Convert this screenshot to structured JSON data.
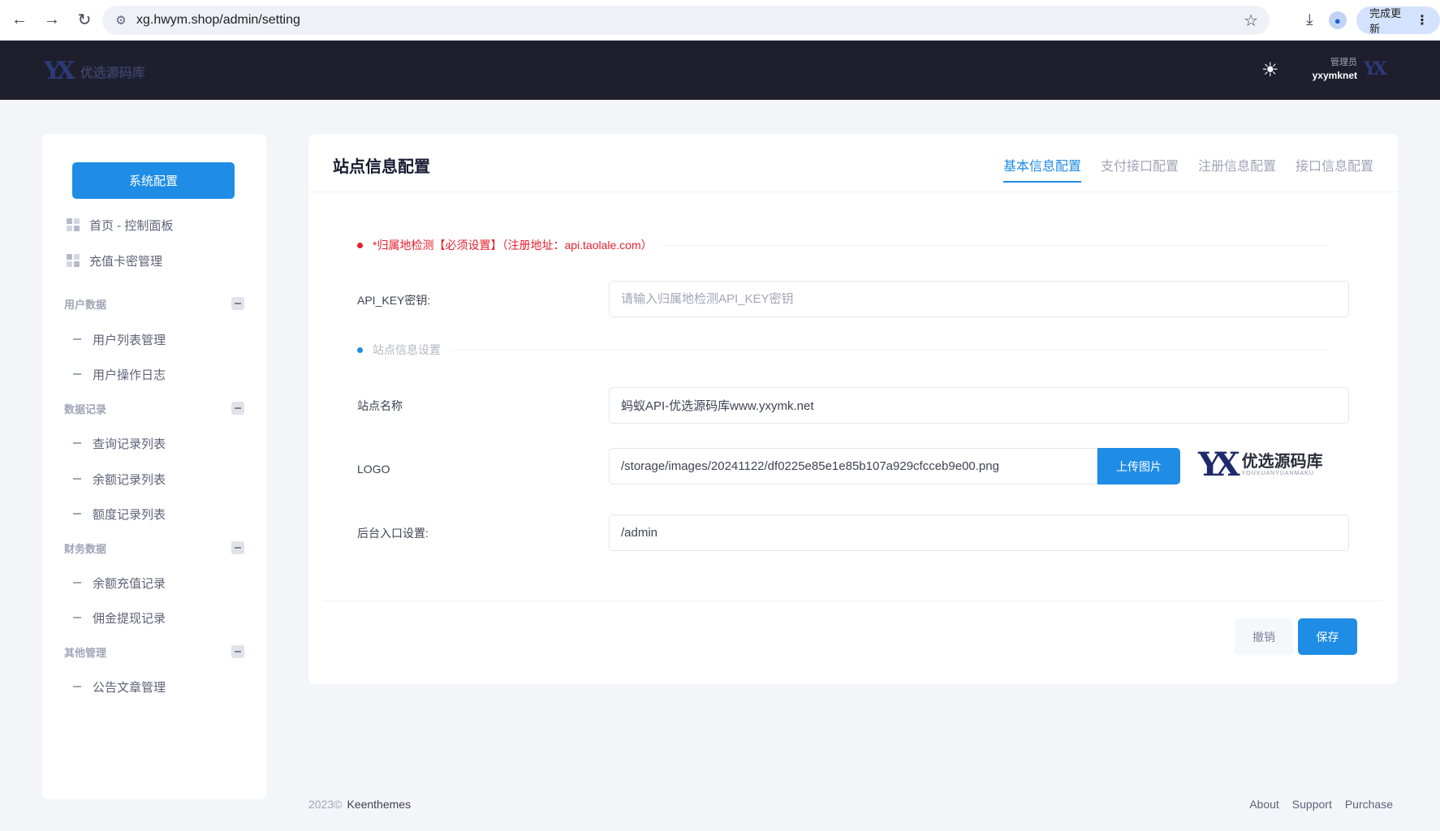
{
  "browser": {
    "url": "xg.hwym.shop/admin/setting",
    "update_label": "完成更新"
  },
  "header": {
    "brand_name": "优选源码库",
    "user_role": "管理员",
    "user_name": "yxymknet"
  },
  "sidebar": {
    "system_button": "系统配置",
    "items": [
      {
        "label": "首页 - 控制面板"
      },
      {
        "label": "充值卡密管理"
      }
    ],
    "sections": [
      {
        "title": "用户数据",
        "items": [
          {
            "label": "用户列表管理"
          },
          {
            "label": "用户操作日志"
          }
        ]
      },
      {
        "title": "数据记录",
        "items": [
          {
            "label": "查询记录列表"
          },
          {
            "label": "余额记录列表"
          },
          {
            "label": "额度记录列表"
          }
        ]
      },
      {
        "title": "财务数据",
        "items": [
          {
            "label": "余额充值记录"
          },
          {
            "label": "佣金提现记录"
          }
        ]
      },
      {
        "title": "其他管理",
        "items": [
          {
            "label": "公告文章管理"
          }
        ]
      }
    ]
  },
  "main": {
    "title": "站点信息配置",
    "tabs": [
      {
        "label": "基本信息配置",
        "active": true
      },
      {
        "label": "支付接口配置",
        "active": false
      },
      {
        "label": "注册信息配置",
        "active": false
      },
      {
        "label": "接口信息配置",
        "active": false
      }
    ],
    "section_geo": "*归属地检测【必须设置】（注册地址：api.taolale.com）",
    "api_key_label": "API_KEY密钥:",
    "api_key_placeholder": "请输入归属地检测API_KEY密钥",
    "api_key_value": "",
    "section_site": "站点信息设置",
    "site_name_label": "站点名称",
    "site_name_value": "蚂蚁API-优选源码库www.yxymk.net",
    "logo_label": "LOGO",
    "logo_value": "/storage/images/20241122/df0225e85e1e85b107a929cfcceb9e00.png",
    "upload_label": "上传图片",
    "logo_preview_cn": "优选源码库",
    "logo_preview_en": "YOUXUANYUANMAKU",
    "admin_entry_label": "后台入口设置:",
    "admin_entry_value": "/admin",
    "cancel_label": "撤销",
    "save_label": "保存"
  },
  "footer": {
    "year": "2023©",
    "brand": "Keenthemes",
    "links": [
      {
        "label": "About"
      },
      {
        "label": "Support"
      },
      {
        "label": "Purchase"
      }
    ]
  },
  "colors": {
    "primary": "#1f8ce6",
    "header_bg": "#1e1e2d",
    "warning_red": "#e5202e",
    "page_bg": "#f3f5f9"
  }
}
